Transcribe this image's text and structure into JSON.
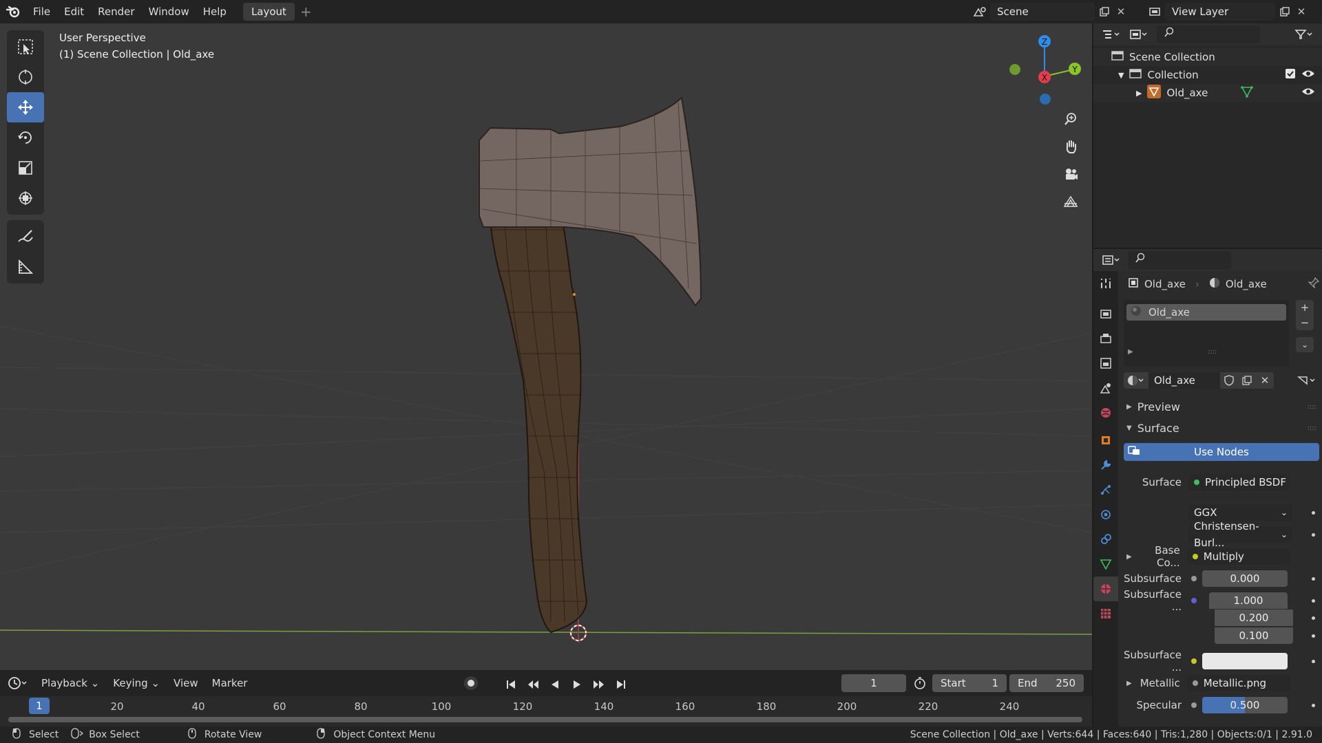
{
  "menu": {
    "file": "File",
    "edit": "Edit",
    "render": "Render",
    "window": "Window",
    "help": "Help"
  },
  "workspace": {
    "active_tab": "Layout",
    "add": "+"
  },
  "scene": {
    "name": "Scene",
    "view_layer": "View Layer"
  },
  "viewport": {
    "perspective": "User Perspective",
    "collection_info": "(1) Scene Collection | Old_axe",
    "gizmo": {
      "z": "Z",
      "y": "Y",
      "x": "X"
    }
  },
  "timeline": {
    "menus": [
      "Playback",
      "Keying",
      "View",
      "Marker"
    ],
    "current_frame": "1",
    "start_label": "Start",
    "start_value": "1",
    "end_label": "End",
    "end_value": "250",
    "ruler_current": "1",
    "ticks": [
      "20",
      "40",
      "60",
      "80",
      "100",
      "120",
      "140",
      "160",
      "180",
      "200",
      "220",
      "240"
    ]
  },
  "statusbar": {
    "select": "Select",
    "box_select": "Box Select",
    "rotate_view": "Rotate View",
    "context_menu": "Object Context Menu",
    "stats": "Scene Collection | Old_axe | Verts:644 | Faces:640 | Tris:1,280 | Objects:0/1 | 2.91.0"
  },
  "outliner": {
    "scene_collection": "Scene Collection",
    "collection": "Collection",
    "object": "Old_axe"
  },
  "properties": {
    "breadcrumb_object": "Old_axe",
    "breadcrumb_material": "Old_axe",
    "slot_name": "Old_axe",
    "material_name": "Old_axe",
    "preview_label": "Preview",
    "surface_panel": "Surface",
    "use_nodes": "Use Nodes",
    "surface_label": "Surface",
    "surface_value": "Principled BSDF",
    "distribution": "GGX",
    "subsurface_method": "Christensen-Burl...",
    "base_color_label": "Base Co...",
    "base_color_value": "Multiply",
    "subsurface_label": "Subsurface",
    "subsurface_value": "0.000",
    "subsurface_radius_label": "Subsurface ...",
    "subsurface_radius": [
      "1.000",
      "0.200",
      "0.100"
    ],
    "subsurface_color_label": "Subsurface ...",
    "metallic_label": "Metallic",
    "metallic_value": "Metallic.png",
    "specular_label": "Specular",
    "specular_value": "0.500",
    "specular_fill": 0.5
  },
  "colors": {
    "accent": "#4772b3",
    "axis_x": "#e53b4e",
    "axis_y": "#8bc32b",
    "axis_z": "#2f8ce8"
  }
}
